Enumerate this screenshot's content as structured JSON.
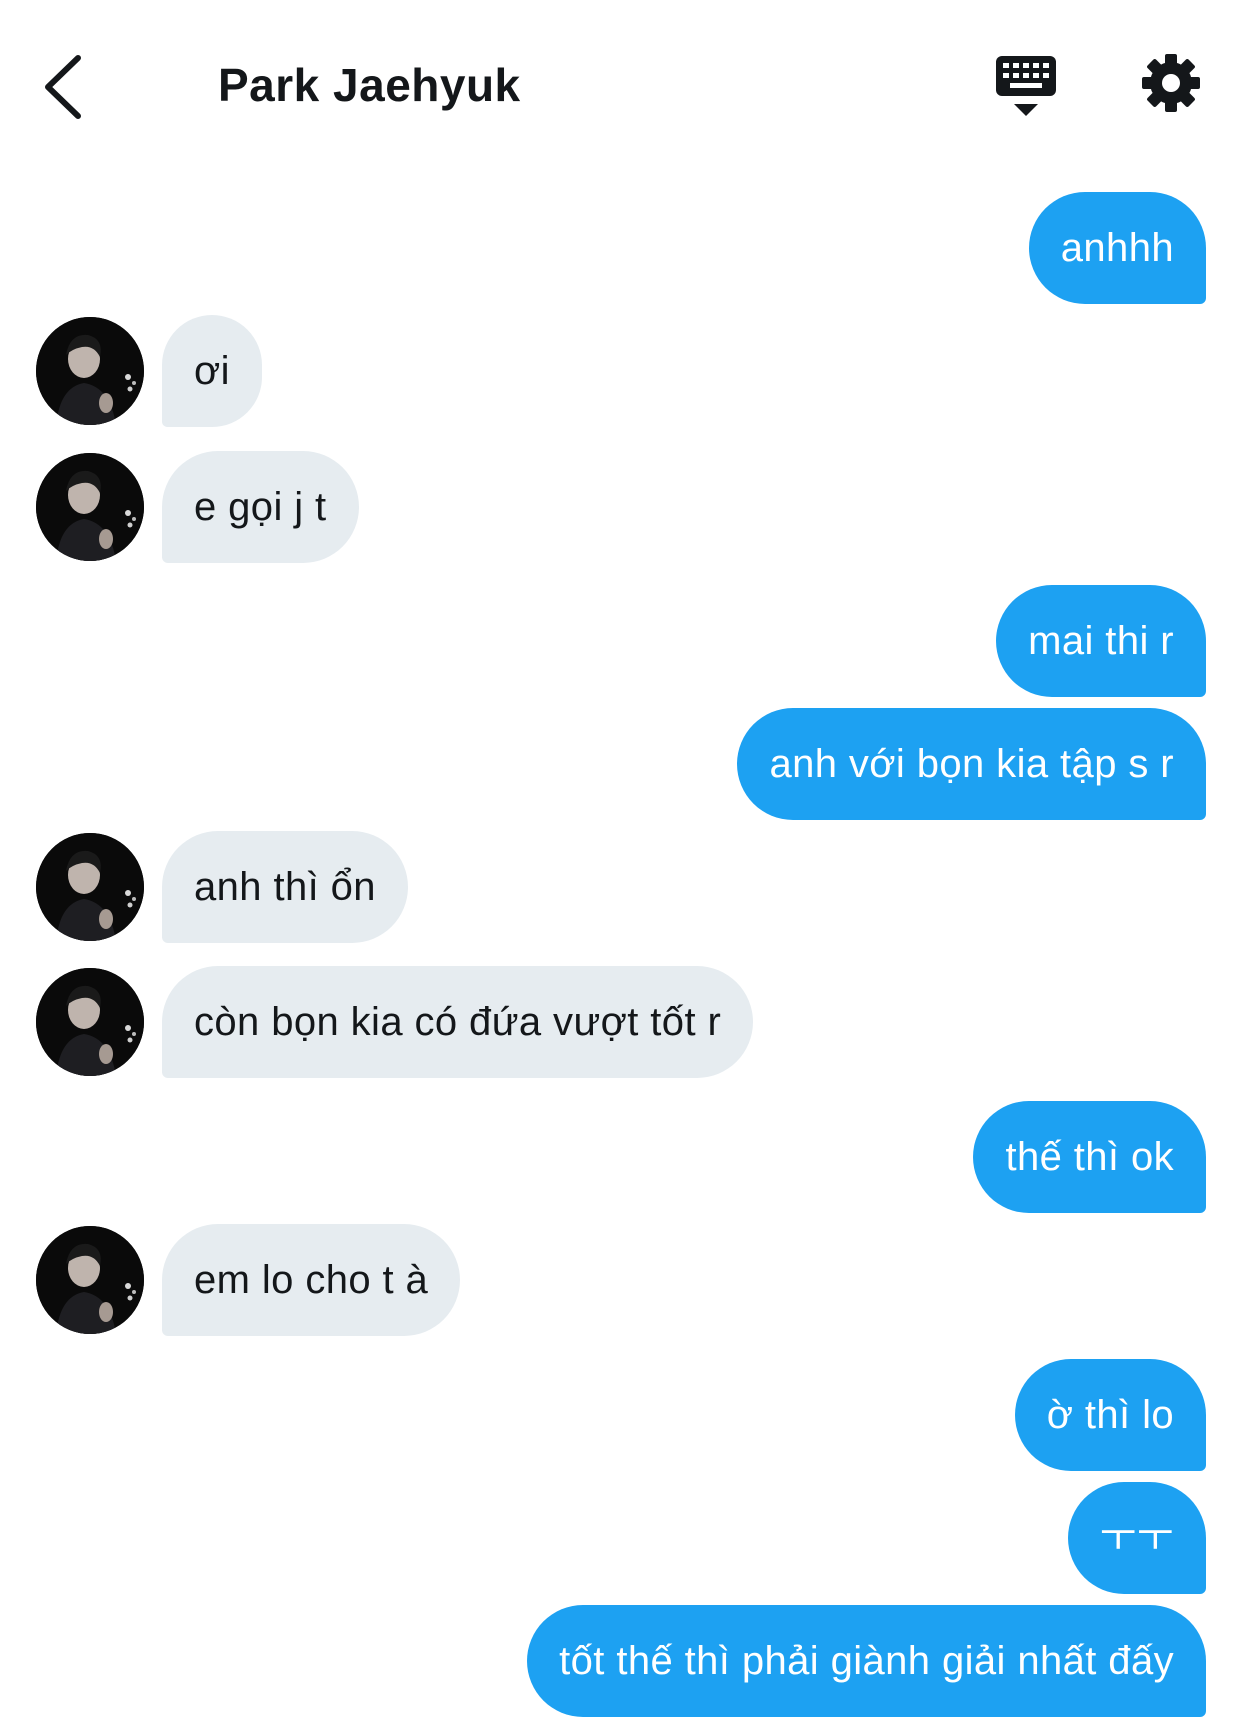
{
  "header": {
    "title": "Park Jaehyuk",
    "back_icon": "chevron-left-icon",
    "keyboard_icon": "keyboard-hide-icon",
    "settings_icon": "gear-icon"
  },
  "colors": {
    "sent_bubble": "#1da1f2",
    "received_bubble": "#e6ecf0",
    "text_dark": "#14171a"
  },
  "messages": [
    {
      "side": "sent",
      "text": "anhhh"
    },
    {
      "side": "received",
      "text": "ơi"
    },
    {
      "side": "received",
      "text": "e gọi j t"
    },
    {
      "side": "sent",
      "text": "mai thi r"
    },
    {
      "side": "sent",
      "text": "anh với bọn kia tập s r"
    },
    {
      "side": "received",
      "text": "anh thì ổn"
    },
    {
      "side": "received",
      "text": "còn bọn kia có đứa vượt tốt r"
    },
    {
      "side": "sent",
      "text": "thế thì ok"
    },
    {
      "side": "received",
      "text": "em lo cho t à"
    },
    {
      "side": "sent",
      "text": "ờ thì lo"
    },
    {
      "side": "sent",
      "text": "ㅜㅜ"
    },
    {
      "side": "sent",
      "text": "tốt thế thì phải giành giải nhất đấy"
    }
  ]
}
